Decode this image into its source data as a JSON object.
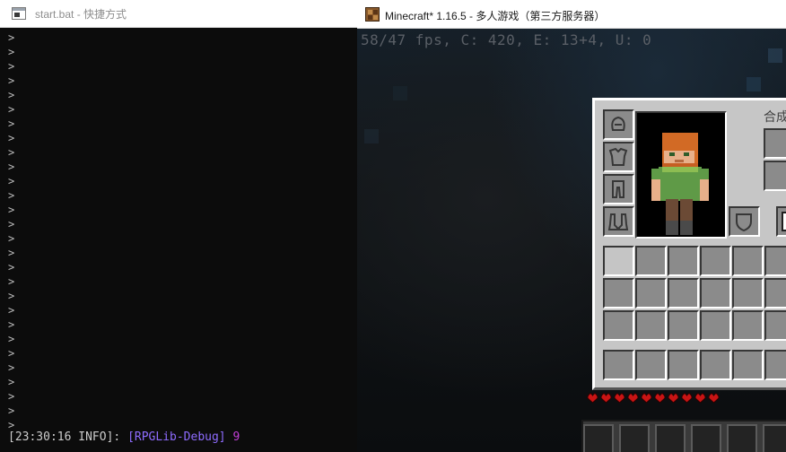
{
  "console": {
    "title": "start.bat - 快捷方式",
    "prompt_glyph": ">",
    "log": {
      "timestamp": "[23:30:16 INFO]: ",
      "tag": "[RPGLib-Debug]",
      "value": " 9"
    }
  },
  "minecraft": {
    "title": "Minecraft* 1.16.5 - 多人游戏（第三方服务器）",
    "debug_overlay": "58/47 fps, C: 420, E: 13+4, U: 0",
    "inventory": {
      "crafting_label": "合成",
      "armor_slots": [
        "helmet",
        "chestplate",
        "leggings",
        "boots"
      ],
      "offhand_slot": "shield",
      "selected_slot": 1
    },
    "hud": {
      "health": 20,
      "max_health": 20,
      "heart_color": "#c81414"
    }
  }
}
